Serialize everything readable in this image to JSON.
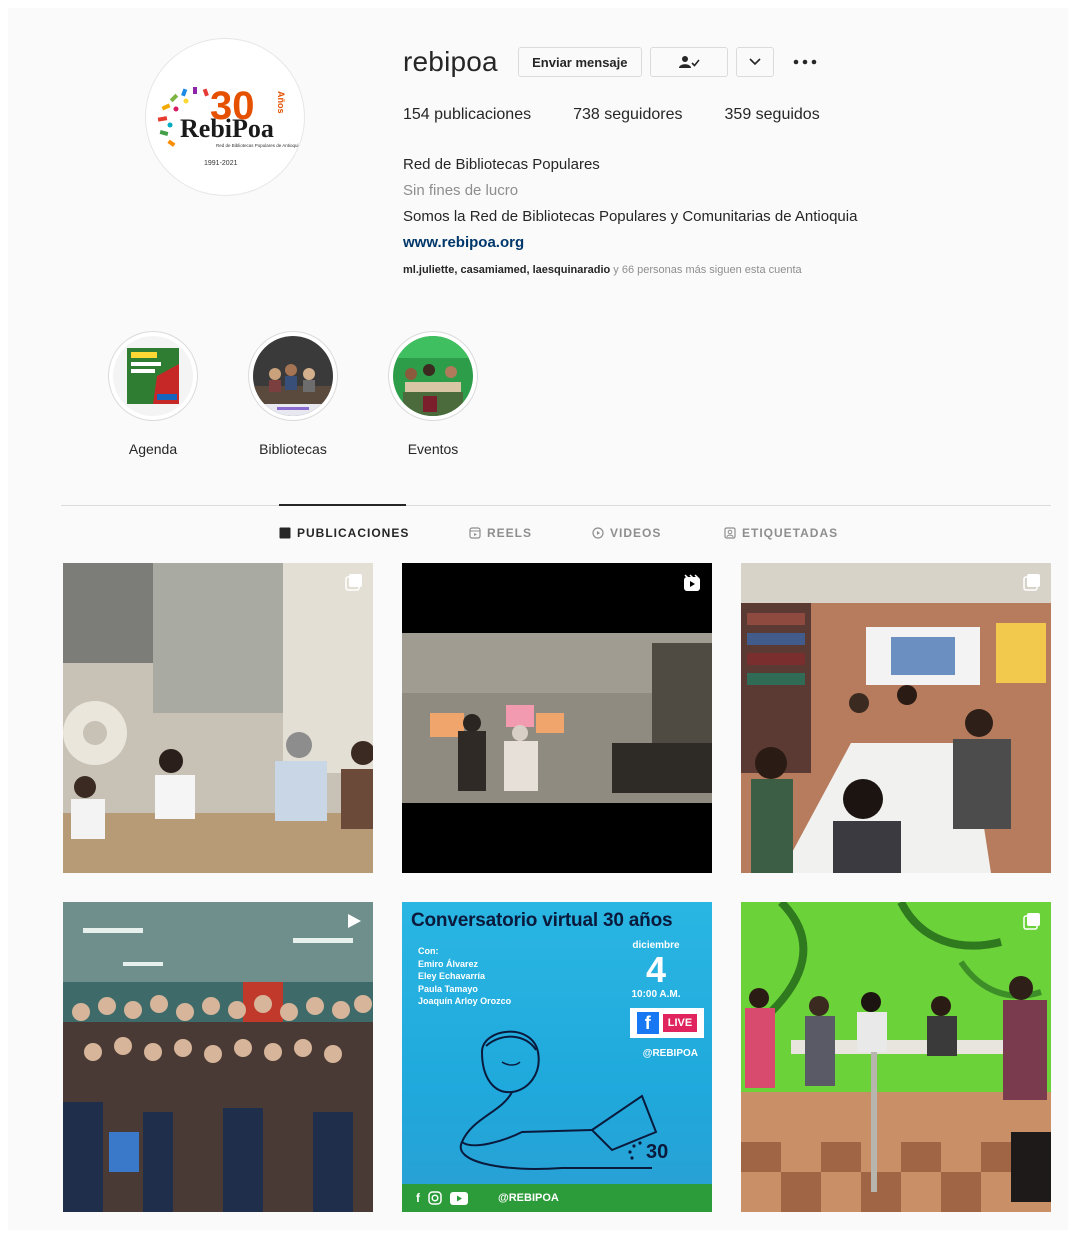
{
  "profile": {
    "username": "rebipoa",
    "message_button": "Enviar mensaje",
    "stats": {
      "posts": "154 publicaciones",
      "followers": "738 seguidores",
      "following": "359 seguidos"
    },
    "name": "Red de Bibliotecas Populares",
    "category": "Sin fines de lucro",
    "bio": "Somos la Red de Bibliotecas Populares y Comunitarias de Antioquia",
    "website": "www.rebipoa.org",
    "followed_by_users": "ml.juliette, casamiamed, laesquinaradio",
    "followed_by_rest": " y 66 personas más siguen esta cuenta",
    "avatar_logo": {
      "number": "30",
      "anos": "Años",
      "brand": "RebiPoa",
      "subtitle": "Red de Bibliotecas Populares de Antioquia",
      "years": "1991-2021"
    }
  },
  "highlights": [
    {
      "label": "Agenda"
    },
    {
      "label": "Bibliotecas"
    },
    {
      "label": "Eventos"
    }
  ],
  "tabs": [
    {
      "label": "PUBLICACIONES",
      "active": true
    },
    {
      "label": "REELS",
      "active": false
    },
    {
      "label": "VIDEOS",
      "active": false
    },
    {
      "label": "ETIQUETADAS",
      "active": false
    }
  ],
  "conversatorio": {
    "title": "Conversatorio virtual 30 años",
    "con_label": "Con:",
    "speakers": [
      "Emiro Álvarez",
      "Eley Echavarría",
      "Paula Tamayo",
      "Joaquín Arloy Orozco"
    ],
    "month": "diciembre",
    "day": "4",
    "time": "10:00 A.M.",
    "live": "LIVE",
    "handle": "@REBIPOA",
    "footer_handle": "@REBIPOA",
    "logo_number": "30"
  },
  "colors": {
    "accent_link": "#00376b",
    "muted": "#8e8e8e",
    "border": "#dbdbdb",
    "text": "#262626"
  }
}
